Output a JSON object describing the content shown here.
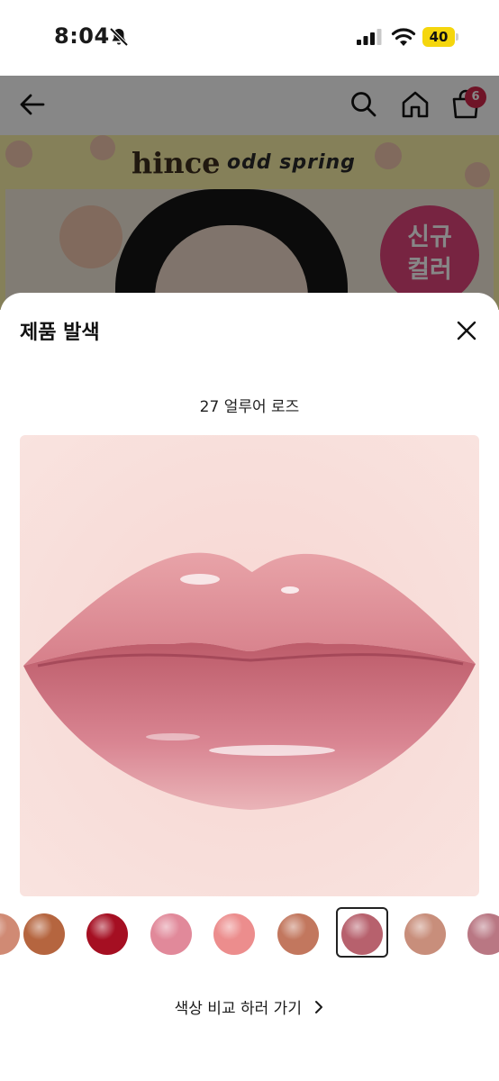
{
  "status_bar": {
    "time": "8:04",
    "battery_level": "40",
    "battery_color": "#f5d60d"
  },
  "header": {
    "back_icon": "arrow-left-icon",
    "search_icon": "search-icon",
    "home_icon": "home-icon",
    "cart_icon": "shopping-bag-icon",
    "cart_count": "6",
    "badge_color": "#d2264a"
  },
  "banner": {
    "brand": "hince",
    "tagline": "odd spring",
    "new_badge_line1": "신규",
    "new_badge_line2": "컬러"
  },
  "sheet": {
    "title": "제품 발색",
    "close_icon": "close-icon",
    "shade_name": "27 얼루어 로즈",
    "compare_link": "색상 비교 하러 가기",
    "swatches": [
      {
        "color": "#d08a74",
        "selected": false
      },
      {
        "color": "#b5653f",
        "selected": false
      },
      {
        "color": "#a50f22",
        "selected": false
      },
      {
        "color": "#e1899a",
        "selected": false
      },
      {
        "color": "#ec8d8d",
        "selected": false
      },
      {
        "color": "#c2775e",
        "selected": false
      },
      {
        "color": "#b7616d",
        "selected": true
      },
      {
        "color": "#c88e7b",
        "selected": false
      },
      {
        "color": "#b97783",
        "selected": false
      }
    ]
  }
}
